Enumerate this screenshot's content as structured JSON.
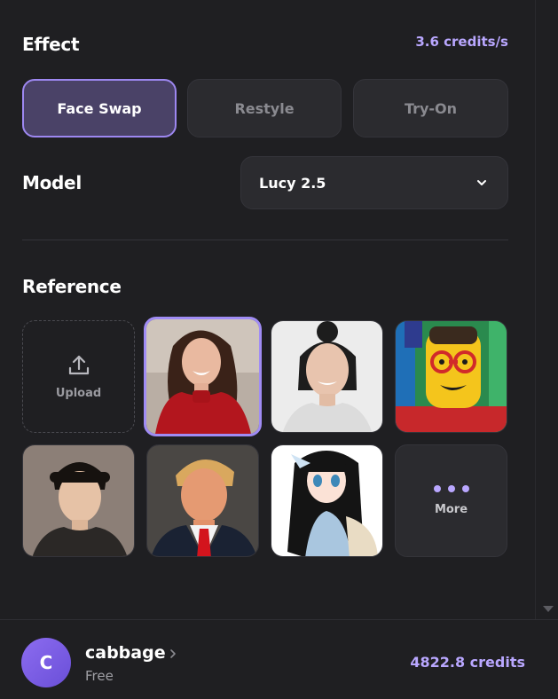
{
  "effect": {
    "title": "Effect",
    "credits_rate": "3.6 credits/s",
    "options": [
      {
        "label": "Face Swap",
        "active": true
      },
      {
        "label": "Restyle",
        "active": false
      },
      {
        "label": "Try-On",
        "active": false
      }
    ]
  },
  "model": {
    "title": "Model",
    "selected": "Lucy 2.5"
  },
  "reference": {
    "title": "Reference",
    "upload_label": "Upload",
    "more_label": "More",
    "items": [
      {
        "icon": "portrait-woman-red-sweater",
        "selected": true
      },
      {
        "icon": "portrait-woman-dark-hair-bun",
        "selected": false
      },
      {
        "icon": "portrait-lego-figure-glasses",
        "selected": false
      },
      {
        "icon": "portrait-young-man",
        "selected": false
      },
      {
        "icon": "portrait-man-suit-red-tie",
        "selected": false
      },
      {
        "icon": "portrait-anime-girl",
        "selected": false
      }
    ]
  },
  "user": {
    "avatar_initial": "C",
    "name": "cabbage",
    "plan": "Free",
    "credits": "4822.8 credits"
  },
  "colors": {
    "accent": "#b9a7ff",
    "active_border": "#9d87f0",
    "background": "#1f1f22"
  }
}
